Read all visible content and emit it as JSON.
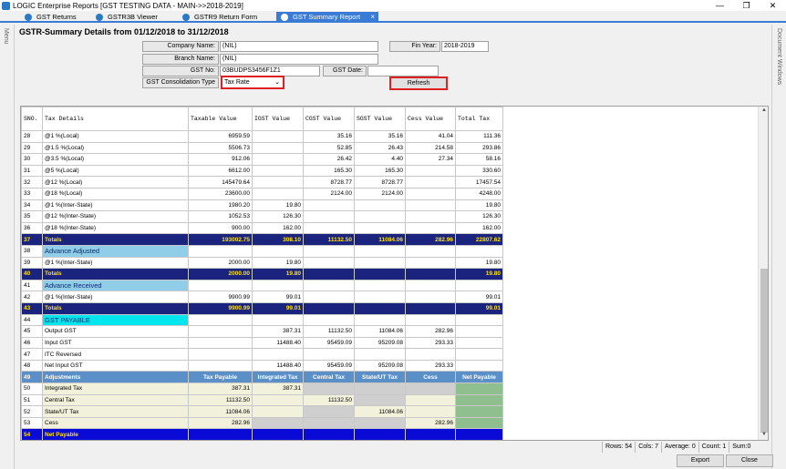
{
  "window": {
    "title": "LOGIC Enterprise Reports  [GST TESTING DATA - MAIN->>2018-2019]"
  },
  "tabs": [
    {
      "label": "GST Returns"
    },
    {
      "label": "GSTR3B Viewer"
    },
    {
      "label": "GSTR9 Return Form"
    },
    {
      "label": "GST Summary Report",
      "close": "×"
    }
  ],
  "side": {
    "left": "Menu",
    "right": "Document Windows"
  },
  "heading": "GSTR-Summary Details from 01/12/2018 to 31/12/2018",
  "form": {
    "company_label": "Company Name:",
    "company_value": "(NIL)",
    "fin_year_label": "Fin Year:",
    "fin_year_value": "2018-2019",
    "branch_label": "Branch Name:",
    "branch_value": "(NIL)",
    "gst_no_label": "GST No:",
    "gst_no_value": "03BUDPS3456F1Z1",
    "gst_date_label": "GST Date:",
    "gst_date_value": "",
    "consolidation_label": "GST Consolidation Type",
    "consolidation_value": "Tax Rate",
    "refresh_label": "Refresh"
  },
  "grid": {
    "columns": [
      "SNO.",
      "Tax Details",
      "Taxable Value",
      "IGST Value",
      "CGST Value",
      "SGST Value",
      "Cess Value",
      "Total Tax"
    ],
    "rows": [
      {
        "sno": "28",
        "detail": "@1 %(Local)",
        "taxable": "6959.59",
        "igst": "",
        "cgst": "35.16",
        "sgst": "35.16",
        "cess": "41.04",
        "total": "111.36"
      },
      {
        "sno": "29",
        "detail": "@1.5 %(Local)",
        "taxable": "5506.73",
        "igst": "",
        "cgst": "52.85",
        "sgst": "26.43",
        "cess": "214.58",
        "total": "293.86"
      },
      {
        "sno": "30",
        "detail": "@3.5 %(Local)",
        "taxable": "912.06",
        "igst": "",
        "cgst": "26.42",
        "sgst": "4.40",
        "cess": "27.34",
        "total": "58.16"
      },
      {
        "sno": "31",
        "detail": "@5 %(Local)",
        "taxable": "6612.00",
        "igst": "",
        "cgst": "165.30",
        "sgst": "165.30",
        "cess": "",
        "total": "330.60"
      },
      {
        "sno": "32",
        "detail": "@12 %(Local)",
        "taxable": "145479.64",
        "igst": "",
        "cgst": "8728.77",
        "sgst": "8728.77",
        "cess": "",
        "total": "17457.54"
      },
      {
        "sno": "33",
        "detail": "@18 %(Local)",
        "taxable": "23600.00",
        "igst": "",
        "cgst": "2124.00",
        "sgst": "2124.00",
        "cess": "",
        "total": "4248.00"
      },
      {
        "sno": "34",
        "detail": "@1 %(Inter-State)",
        "taxable": "1980.20",
        "igst": "19.80",
        "cgst": "",
        "sgst": "",
        "cess": "",
        "total": "19.80"
      },
      {
        "sno": "35",
        "detail": "@12 %(Inter-State)",
        "taxable": "1052.53",
        "igst": "126.30",
        "cgst": "",
        "sgst": "",
        "cess": "",
        "total": "126.30"
      },
      {
        "sno": "36",
        "detail": "@18 %(Inter-State)",
        "taxable": "900.00",
        "igst": "162.00",
        "cgst": "",
        "sgst": "",
        "cess": "",
        "total": "162.00"
      },
      {
        "type": "totals",
        "sno": "37",
        "detail": "Totals",
        "taxable": "193002.75",
        "igst": "308.10",
        "cgst": "11132.50",
        "sgst": "11084.06",
        "cess": "282.96",
        "total": "22807.62"
      },
      {
        "type": "section-light",
        "sno": "38",
        "detail": "Advance Adjusted"
      },
      {
        "sno": "39",
        "detail": "@1 %(Inter-State)",
        "taxable": "2000.00",
        "igst": "19.80",
        "cgst": "",
        "sgst": "",
        "cess": "",
        "total": "19.80"
      },
      {
        "type": "totals",
        "sno": "40",
        "detail": "Totals",
        "taxable": "2000.00",
        "igst": "19.80",
        "cgst": "",
        "sgst": "",
        "cess": "",
        "total": "19.80"
      },
      {
        "type": "section-light",
        "sno": "41",
        "detail": "Advance Received"
      },
      {
        "sno": "42",
        "detail": "@1 %(Inter-State)",
        "taxable": "9900.99",
        "igst": "99.01",
        "cgst": "",
        "sgst": "",
        "cess": "",
        "total": "99.01"
      },
      {
        "type": "totals",
        "sno": "43",
        "detail": "Totals",
        "taxable": "9900.99",
        "igst": "99.01",
        "cgst": "",
        "sgst": "",
        "cess": "",
        "total": "99.01"
      },
      {
        "type": "section-cyan",
        "sno": "44",
        "detail": "GST PAYABLE"
      },
      {
        "sno": "45",
        "detail": "Output GST",
        "taxable": "",
        "igst": "387.31",
        "cgst": "11132.50",
        "sgst": "11084.06",
        "cess": "282.96",
        "total": ""
      },
      {
        "sno": "46",
        "detail": "Input GST",
        "taxable": "",
        "igst": "11488.40",
        "cgst": "95459.09",
        "sgst": "95209.08",
        "cess": "293.33",
        "total": ""
      },
      {
        "sno": "47",
        "detail": "ITC Reversed",
        "taxable": "",
        "igst": "",
        "cgst": "",
        "sgst": "",
        "cess": "",
        "total": ""
      },
      {
        "sno": "48",
        "detail": "Net Input GST",
        "taxable": "",
        "igst": "11488.40",
        "cgst": "95459.09",
        "sgst": "95209.08",
        "cess": "293.33",
        "total": ""
      },
      {
        "type": "adj-header",
        "sno": "49",
        "detail": "Adjustments",
        "taxable": "Tax Payable",
        "igst": "Integrated Tax",
        "cgst": "Central Tax",
        "sgst": "State/UT Tax",
        "cess": "Cess",
        "total": "Net Payable"
      },
      {
        "type": "adj",
        "sno": "50",
        "detail": "Integrated Tax",
        "taxable": "387.31",
        "igst": "387.31",
        "cgst": "",
        "sgst": "",
        "cess": "",
        "total": "",
        "grey": [
          "cgst",
          "sgst",
          "cess"
        ]
      },
      {
        "type": "adj",
        "sno": "51",
        "detail": "Central Tax",
        "taxable": "11132.50",
        "igst": "",
        "cgst": "11132.50",
        "sgst": "",
        "cess": "",
        "total": "",
        "grey": [
          "sgst"
        ]
      },
      {
        "type": "adj",
        "sno": "52",
        "detail": "State/UT Tax",
        "taxable": "11084.06",
        "igst": "",
        "cgst": "",
        "sgst": "11084.06",
        "cess": "",
        "total": "",
        "grey": [
          "cgst"
        ]
      },
      {
        "type": "adj",
        "sno": "53",
        "detail": "Cess",
        "taxable": "282.96",
        "igst": "",
        "cgst": "",
        "sgst": "",
        "cess": "282.96",
        "total": "",
        "grey": [
          "igst",
          "cgst",
          "sgst"
        ]
      },
      {
        "type": "net",
        "sno": "54",
        "detail": "Net Payable"
      }
    ]
  },
  "status": {
    "rows": "Rows: 54",
    "cols": "Cols: 7",
    "average": "Average: 0",
    "count": "Count: 1",
    "sum": "Sum:0"
  },
  "buttons": {
    "export": "Export",
    "close": "Close"
  }
}
